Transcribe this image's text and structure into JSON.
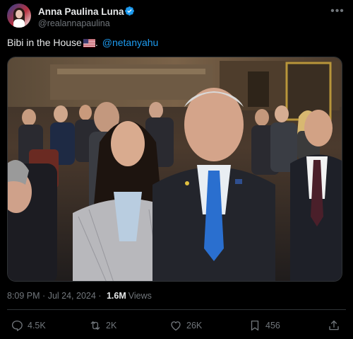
{
  "author": {
    "name": "Anna Paulina Luna",
    "handle": "@realannapaulina",
    "verified_color": "#1d9bf0"
  },
  "tweet": {
    "text": "Bibi in the House",
    "flag_emoji": "🇺🇸",
    "text_suffix": ".",
    "mention": "@netanyahu"
  },
  "media": {
    "type": "photo",
    "description_icon": "photo"
  },
  "meta": {
    "time": "8:09 PM",
    "separator": "·",
    "date": "Jul 24, 2024",
    "separator2": "·",
    "views_count": "1.6M",
    "views_label": "Views"
  },
  "actions": {
    "replies": "4.5K",
    "reposts": "2K",
    "likes": "26K",
    "bookmarks": "456"
  },
  "colors": {
    "background": "#000000",
    "text": "#e7e9ea",
    "muted": "#71767b",
    "accent": "#1d9bf0",
    "divider": "#2f3336"
  }
}
